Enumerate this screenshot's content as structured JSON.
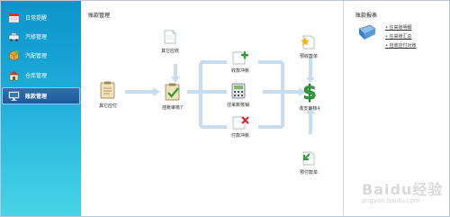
{
  "sidebar": {
    "items": [
      {
        "label": "日常提醒",
        "icon": "calendar-icon"
      },
      {
        "label": "汽修管理",
        "icon": "car-icon"
      },
      {
        "label": "汽配管理",
        "icon": "parts-box-icon"
      },
      {
        "label": "仓库管理",
        "icon": "warehouse-icon"
      },
      {
        "label": "账款管理",
        "icon": "monitor-icon",
        "active": true
      }
    ]
  },
  "main": {
    "title": "账款管理",
    "nodes": {
      "other_receivable": "其它应收",
      "other_payable": "其它应付",
      "audit": "挂账审核",
      "audit_badge": "7",
      "receipt_offset": "收款冲账",
      "ledger_query": "往来账核销",
      "payment_offset": "付款冲账",
      "advance_receipt": "预收款单",
      "receipt_payment_audit": "收支审核",
      "receipt_payment_badge": "4",
      "advance_payment": "预付款单"
    }
  },
  "right_panel": {
    "title": "账款报表",
    "links": [
      "往来账明细",
      "往来账汇总",
      "应收应付对账"
    ]
  },
  "watermark": {
    "text": "Baidu经验",
    "sub": "jingyan.baidu.com"
  },
  "colors": {
    "sidebar_top": "#0e93c9",
    "sidebar_bottom": "#49d3e6",
    "flow_line": "#c8dcef",
    "badge": "#1a4c8a"
  }
}
